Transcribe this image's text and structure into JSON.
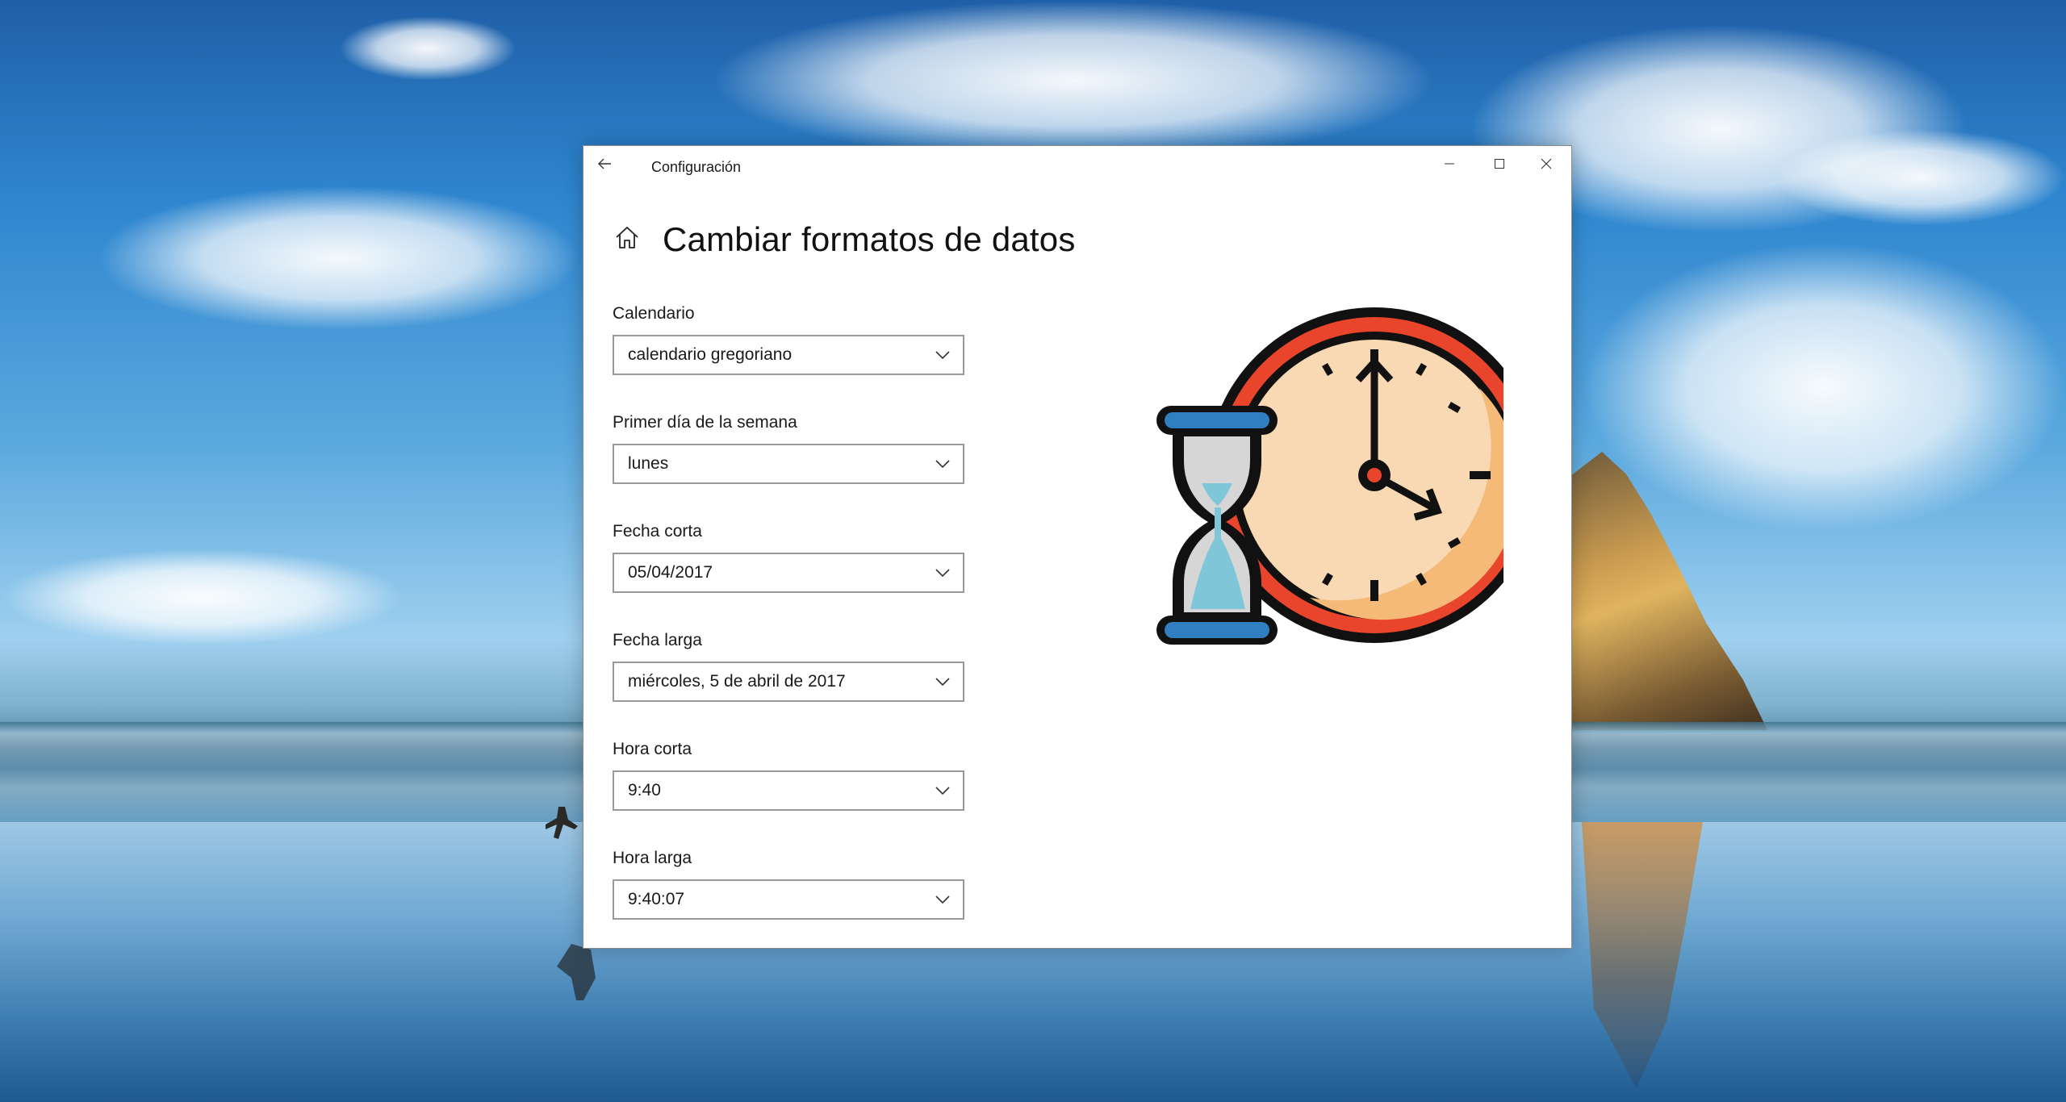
{
  "window": {
    "title": "Configuración"
  },
  "page": {
    "title": "Cambiar formatos de datos"
  },
  "fields": [
    {
      "label": "Calendario",
      "value": "calendario gregoriano"
    },
    {
      "label": "Primer día de la semana",
      "value": "lunes"
    },
    {
      "label": "Fecha corta",
      "value": "05/04/2017"
    },
    {
      "label": "Fecha larga",
      "value": "miércoles, 5 de abril de 2017"
    },
    {
      "label": "Hora corta",
      "value": "9:40"
    },
    {
      "label": "Hora larga",
      "value": "9:40:07"
    }
  ],
  "icons": {
    "back": "back-arrow-icon",
    "home": "home-icon",
    "minimize": "minimize-icon",
    "maximize": "maximize-icon",
    "close": "close-icon",
    "dropdown": "chevron-down-icon",
    "illustration": "clock-hourglass-icon"
  },
  "colors": {
    "window_bg": "#ffffff",
    "dropdown_border": "#999999",
    "clock_ring": "#e8452c",
    "clock_face": "#f8d9b4",
    "hourglass_cap": "#2f7fc1",
    "hourglass_glass": "#d6d6d6",
    "sand": "#7fc6d8"
  }
}
